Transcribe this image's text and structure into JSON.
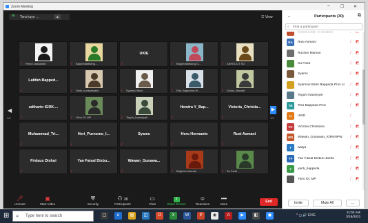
{
  "window": {
    "title": "Zoom Meeting",
    "controls": [
      "–",
      "☐",
      "✕"
    ]
  },
  "meeting": {
    "pill_text": "Tera kuyo ...",
    "box": "■"
  },
  "view": {
    "label": "☷ View"
  },
  "grid": {
    "page_left": "1/2",
    "page_right": "1/2",
    "tiles": [
      {
        "name": "",
        "caption": "Rendi Jalaluddin"
      },
      {
        "name": "",
        "caption": "Bappedalitbang...."
      },
      {
        "name": "UKIE",
        "caption": ""
      },
      {
        "name": "",
        "caption": "Bappedalitbang O..."
      },
      {
        "name": "",
        "caption": "ASHELIUT SD"
      },
      {
        "name": "Latifah Bapped...",
        "caption": ""
      },
      {
        "name": "",
        "caption": "Dewi_nonspesialis"
      },
      {
        "name": "",
        "caption": "Syamsu Bkor..."
      },
      {
        "name": "",
        "caption": "Rini_Bappeda UK..."
      },
      {
        "name": "",
        "caption": "Solusi_Mandiri"
      },
      {
        "name": "udiharto IGRK-...",
        "caption": ""
      },
      {
        "name": "",
        "caption": "Yitno Dt. MP"
      },
      {
        "name": "",
        "caption": "Teguh_Irwansyah"
      },
      {
        "name": "Hendra Y_Bap...",
        "caption": ""
      },
      {
        "name": "Victoria_Christia...",
        "caption": ""
      },
      {
        "name": "Muhammad_Tri...",
        "caption": ""
      },
      {
        "name": "Heri_Purnomo_I...",
        "caption": ""
      },
      {
        "name": "Syams",
        "caption": ""
      },
      {
        "name": "Heru Hermanto",
        "caption": ""
      },
      {
        "name": "Rusi Asmani",
        "caption": ""
      },
      {
        "name": "Firdaus Dishut",
        "caption": ""
      },
      {
        "name": "Yan Faisal Disbu...",
        "caption": ""
      },
      {
        "name": "Wawan_Gunawa...",
        "caption": ""
      },
      {
        "name": "",
        "caption": "Bagindo Ishmail"
      },
      {
        "name": "",
        "caption": "Su Farid"
      }
    ]
  },
  "toolbar": {
    "buttons": [
      {
        "icon": "🎤",
        "label": "Unmute"
      },
      {
        "icon": "📹",
        "label": "Start Video"
      },
      {
        "icon": "🛡",
        "label": "Security"
      },
      {
        "icon": "👥",
        "label": "Participants",
        "count": "30"
      },
      {
        "icon": "💬",
        "label": "Chat"
      },
      {
        "icon": "⇧",
        "label": "Share Screen"
      },
      {
        "icon": "☺",
        "label": "Reactions"
      },
      {
        "icon": "•••",
        "label": "More"
      }
    ],
    "end_label": "End"
  },
  "panel": {
    "title": "Participants (30)",
    "search_placeholder": "Find a participant",
    "rows": [
      {
        "initials": "",
        "name": "Muhammad Tri Susanto",
        "color": "#c14f2f"
      },
      {
        "initials": "RA",
        "name": "Rusi Asmani",
        "color": "#3b6fb6"
      },
      {
        "initials": "",
        "name": "Rochim Mamun",
        "color": "#6e6e6e"
      },
      {
        "initials": "",
        "name": "Su Farid",
        "color": "#4a8a3a"
      },
      {
        "initials": "",
        "name": "Syams",
        "color": "#7a5a3a"
      },
      {
        "initials": "",
        "name": "Syamsul Bahri Bappeda Prov Ja...",
        "color": "#d4a020"
      },
      {
        "initials": "",
        "name": "Teguh Irwansyah",
        "color": "#5a7a8a"
      },
      {
        "initials": "TB",
        "name": "Tera Bappeda Prov",
        "color": "#2a9a9a"
      },
      {
        "initials": "U",
        "name": "UKIE",
        "color": "#e07a1a"
      },
      {
        "initials": "VC",
        "name": "Victoria Christiana",
        "color": "#c23a3a"
      },
      {
        "initials": "WG",
        "name": "Wawan_Gunawan_IGRKNPW",
        "color": "#c2582a"
      },
      {
        "initials": "Y",
        "name": "widya",
        "color": "#2a7ac2"
      },
      {
        "initials": "YF",
        "name": "Yan Faisal Disbun Jambi",
        "color": "#2a6ab6"
      },
      {
        "initials": "Y",
        "name": "yanti_bappeda",
        "color": "#3a9a4a"
      },
      {
        "initials": "",
        "name": "Yitno Dt. MP",
        "color": "#555555"
      }
    ],
    "footer": {
      "invite": "Invite",
      "mute_all": "Mute All",
      "more": "..."
    }
  },
  "taskbar": {
    "search_text": "Type here to search",
    "time": "11:03 AM",
    "date": "3/18/2021",
    "tray": "^ ◻ 🔊 ENG"
  },
  "colors": {
    "accent": "#2d8cff",
    "end": "#e02828",
    "muted": "#e53a3a"
  }
}
